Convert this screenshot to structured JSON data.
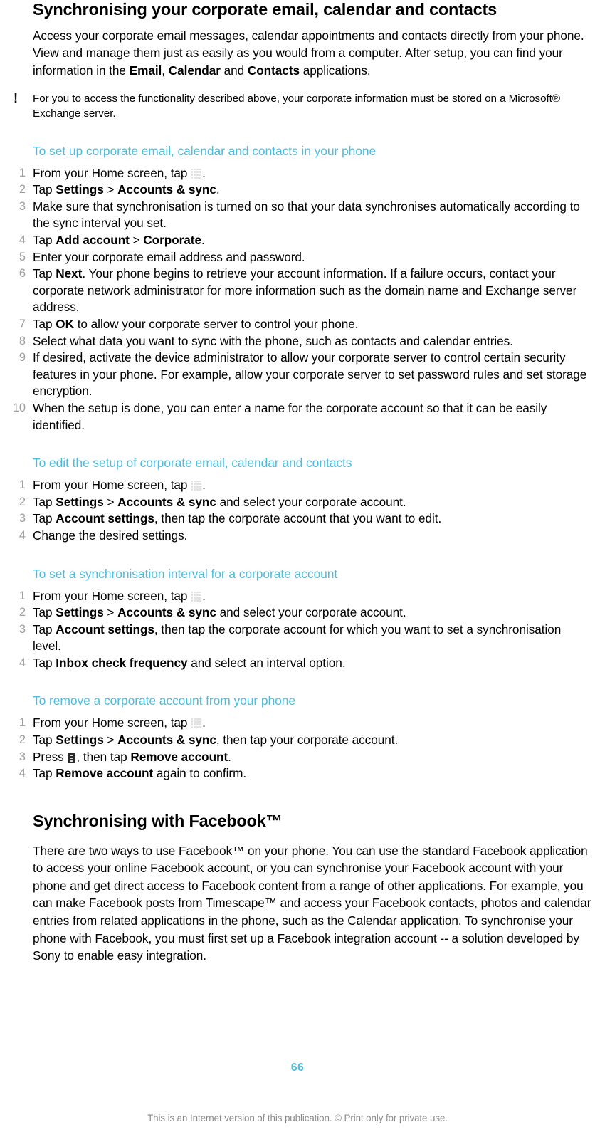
{
  "colors": {
    "accent": "#4BBDDF",
    "list_number": "#9E9E9E",
    "body_text": "#000000",
    "footer_text": "#8A8A8A"
  },
  "doc": {
    "title": "Synchronising your corporate email, calendar and contacts",
    "intro_parts": {
      "p1": "Access your corporate email messages, calendar appointments and contacts directly from your phone. View and manage them just as easily as you would from a computer. After setup, you can find your information in the ",
      "b1": "Email",
      "p2": ", ",
      "b2": "Calendar",
      "p3": " and ",
      "b3": "Contacts",
      "p4": " applications."
    },
    "note": {
      "icon": "exclamation-icon",
      "icon_glyph": "!",
      "text": "For you to access the functionality described above, your corporate information must be stored on a Microsoft® Exchange server."
    }
  },
  "section1": {
    "heading": "To set up corporate email, calendar and contacts in your phone",
    "steps": [
      {
        "num": "1",
        "parts": [
          {
            "type": "text",
            "value": "From your Home screen, tap "
          },
          {
            "type": "icon",
            "value": "app-drawer-grid-icon"
          },
          {
            "type": "text",
            "value": "."
          }
        ]
      },
      {
        "num": "2",
        "parts": [
          {
            "type": "text",
            "value": "Tap "
          },
          {
            "type": "bold",
            "value": "Settings"
          },
          {
            "type": "text",
            "value": " > "
          },
          {
            "type": "bold",
            "value": "Accounts & sync"
          },
          {
            "type": "text",
            "value": "."
          }
        ]
      },
      {
        "num": "3",
        "parts": [
          {
            "type": "text",
            "value": "Make sure that synchronisation is turned on so that your data synchronises automatically according to the sync interval you set."
          }
        ]
      },
      {
        "num": "4",
        "parts": [
          {
            "type": "text",
            "value": "Tap "
          },
          {
            "type": "bold",
            "value": "Add account"
          },
          {
            "type": "text",
            "value": " > "
          },
          {
            "type": "bold",
            "value": "Corporate"
          },
          {
            "type": "text",
            "value": "."
          }
        ]
      },
      {
        "num": "5",
        "parts": [
          {
            "type": "text",
            "value": "Enter your corporate email address and password."
          }
        ]
      },
      {
        "num": "6",
        "parts": [
          {
            "type": "text",
            "value": "Tap "
          },
          {
            "type": "bold",
            "value": "Next"
          },
          {
            "type": "text",
            "value": ". Your phone begins to retrieve your account information. If a failure occurs, contact your corporate network administrator for more information such as the domain name and Exchange server address."
          }
        ]
      },
      {
        "num": "7",
        "parts": [
          {
            "type": "text",
            "value": "Tap "
          },
          {
            "type": "bold",
            "value": "OK"
          },
          {
            "type": "text",
            "value": " to allow your corporate server to control your phone."
          }
        ]
      },
      {
        "num": "8",
        "parts": [
          {
            "type": "text",
            "value": "Select what data you want to sync with the phone, such as contacts and calendar entries."
          }
        ]
      },
      {
        "num": "9",
        "parts": [
          {
            "type": "text",
            "value": "If desired, activate the device administrator to allow your corporate server to control certain security features in your phone. For example, allow your corporate server to set password rules and set storage encryption."
          }
        ]
      },
      {
        "num": "10",
        "parts": [
          {
            "type": "text",
            "value": "When the setup is done, you can enter a name for the corporate account so that it can be easily identified."
          }
        ]
      }
    ]
  },
  "section2": {
    "heading": "To edit the setup of corporate email, calendar and contacts",
    "steps": [
      {
        "num": "1",
        "parts": [
          {
            "type": "text",
            "value": "From your Home screen, tap "
          },
          {
            "type": "icon",
            "value": "app-drawer-grid-icon"
          },
          {
            "type": "text",
            "value": "."
          }
        ]
      },
      {
        "num": "2",
        "parts": [
          {
            "type": "text",
            "value": "Tap "
          },
          {
            "type": "bold",
            "value": "Settings"
          },
          {
            "type": "text",
            "value": " > "
          },
          {
            "type": "bold",
            "value": "Accounts & sync"
          },
          {
            "type": "text",
            "value": " and select your corporate account."
          }
        ]
      },
      {
        "num": "3",
        "parts": [
          {
            "type": "text",
            "value": "Tap "
          },
          {
            "type": "bold",
            "value": "Account settings"
          },
          {
            "type": "text",
            "value": ", then tap the corporate account that you want to edit."
          }
        ]
      },
      {
        "num": "4",
        "parts": [
          {
            "type": "text",
            "value": "Change the desired settings."
          }
        ]
      }
    ]
  },
  "section3": {
    "heading": "To set a synchronisation interval for a corporate account",
    "steps": [
      {
        "num": "1",
        "parts": [
          {
            "type": "text",
            "value": "From your Home screen, tap "
          },
          {
            "type": "icon",
            "value": "app-drawer-grid-icon"
          },
          {
            "type": "text",
            "value": "."
          }
        ]
      },
      {
        "num": "2",
        "parts": [
          {
            "type": "text",
            "value": "Tap "
          },
          {
            "type": "bold",
            "value": "Settings"
          },
          {
            "type": "text",
            "value": " > "
          },
          {
            "type": "bold",
            "value": "Accounts & sync"
          },
          {
            "type": "text",
            "value": " and select your corporate account."
          }
        ]
      },
      {
        "num": "3",
        "parts": [
          {
            "type": "text",
            "value": "Tap "
          },
          {
            "type": "bold",
            "value": "Account settings"
          },
          {
            "type": "text",
            "value": ", then tap the corporate account for which you want to set a synchronisation level."
          }
        ]
      },
      {
        "num": "4",
        "parts": [
          {
            "type": "text",
            "value": "Tap "
          },
          {
            "type": "bold",
            "value": "Inbox check frequency"
          },
          {
            "type": "text",
            "value": " and select an interval option."
          }
        ]
      }
    ]
  },
  "section4": {
    "heading": "To remove a corporate account from your phone",
    "steps": [
      {
        "num": "1",
        "parts": [
          {
            "type": "text",
            "value": "From your Home screen, tap "
          },
          {
            "type": "icon",
            "value": "app-drawer-grid-icon"
          },
          {
            "type": "text",
            "value": "."
          }
        ]
      },
      {
        "num": "2",
        "parts": [
          {
            "type": "text",
            "value": "Tap "
          },
          {
            "type": "bold",
            "value": "Settings"
          },
          {
            "type": "text",
            "value": " > "
          },
          {
            "type": "bold",
            "value": "Accounts & sync"
          },
          {
            "type": "text",
            "value": ", then tap your corporate account."
          }
        ]
      },
      {
        "num": "3",
        "parts": [
          {
            "type": "text",
            "value": "Press "
          },
          {
            "type": "icon",
            "value": "overflow-menu-icon"
          },
          {
            "type": "text",
            "value": ", then tap "
          },
          {
            "type": "bold",
            "value": "Remove account"
          },
          {
            "type": "text",
            "value": "."
          }
        ]
      },
      {
        "num": "4",
        "parts": [
          {
            "type": "text",
            "value": "Tap "
          },
          {
            "type": "bold",
            "value": "Remove account"
          },
          {
            "type": "text",
            "value": " again to confirm."
          }
        ]
      }
    ]
  },
  "facebook": {
    "title": "Synchronising with Facebook™",
    "paragraph": "There are two ways to use Facebook™ on your phone. You can use the standard Facebook application to access your online Facebook account, or you can synchronise your Facebook account with your phone and get direct access to Facebook content from a range of other applications. For example, you can make Facebook posts from Timescape™ and access your Facebook contacts, photos and calendar entries from related applications in the phone, such as the Calendar application. To synchronise your phone with Facebook, you must first set up a Facebook integration account -- a solution developed by Sony to enable easy integration."
  },
  "footer": {
    "page_number": "66",
    "notice": "This is an Internet version of this publication. © Print only for private use."
  }
}
